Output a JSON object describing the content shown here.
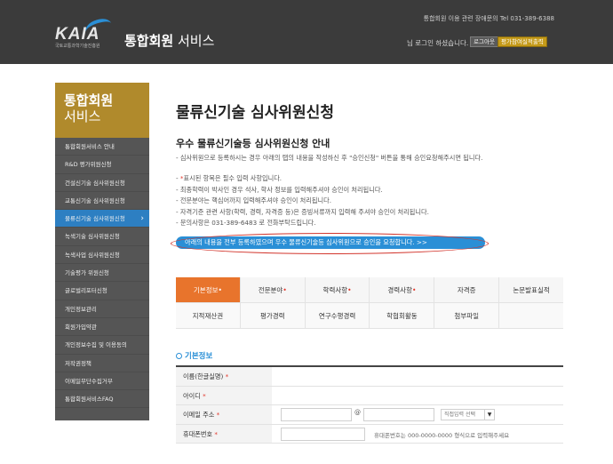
{
  "header": {
    "logo_text": "KAIA",
    "logo_sub": "국토교통과학기술진흥원",
    "service_title_bold": "통합회원",
    "service_title_rest": " 서비스",
    "contact": "통합회원 이용 관련 장애문의 Tel 031-389-6388",
    "login_status": "님 로그인 하셨습니다.",
    "logout_label": "로그아웃",
    "eval_label": "평가참여실적출력"
  },
  "sidebar": {
    "title_line1": "통합회원",
    "title_line2": "서비스",
    "items": [
      {
        "label": "통합회원서비스 안내"
      },
      {
        "label": "R&D 평가위원신청"
      },
      {
        "label": "건설신기술 심사위원신청"
      },
      {
        "label": "교통신기술 심사위원신청"
      },
      {
        "label": "물류신기술 심사위원신청"
      },
      {
        "label": "녹색기술 심사위원신청"
      },
      {
        "label": "녹색사업 심사위원신청"
      },
      {
        "label": "기술평가 위원신청"
      },
      {
        "label": "글로벌리포터신청"
      },
      {
        "label": "개인정보관리"
      },
      {
        "label": "회원가입약관"
      },
      {
        "label": "개인정보수집 및 이용동의"
      },
      {
        "label": "저작권정책"
      },
      {
        "label": "이메일무단수집거부"
      },
      {
        "label": "통합회원서비스FAQ"
      }
    ]
  },
  "main": {
    "page_title": "물류신기술 심사위원신청",
    "section_title": "우수 물류신기술등 심사위원신청 안내",
    "intro": "- 심사위원으로 등록하시는 경우 아래의 탭의 내용을 작성하신 후 \"승인신청\" 버튼을 통해 승인요청해주시면 됩니다.",
    "note_required_prefix": "- ",
    "note_required_mark": "*",
    "note_required_text": "표시된 항목은 필수 입력 사항입니다.",
    "notes": [
      "- 최종학력이 박사인 경우 석사, 학사 정보를 입력해주셔야 승인이 처리됩니다.",
      "- 전문분야는 핵심어까지 입력해주셔야 승인이 처리됩니다.",
      "- 자격기준 관련 사항(학력, 경력, 자격증 등)은 증빙서류까지 입력해 주셔야 승인이 처리됩니다.",
      "- 문의사항은 031-389-6483 로 전화부탁드립니다."
    ],
    "request_link": "아래의 내용을 전부 등록하였으며 우수 물류신기술등 심사위원으로 승인을 요청합니다. >>"
  },
  "tabs": {
    "row1": [
      {
        "label": "기본정보",
        "required": "•"
      },
      {
        "label": "전문분야",
        "required": "•"
      },
      {
        "label": "학력사항",
        "required": "•"
      },
      {
        "label": "경력사항",
        "required": "•"
      },
      {
        "label": "자격증",
        "required": ""
      },
      {
        "label": "논문발표실적",
        "required": ""
      }
    ],
    "row2": [
      {
        "label": "지적재산권"
      },
      {
        "label": "평가경력"
      },
      {
        "label": "연구수행경력"
      },
      {
        "label": "학협회활동"
      },
      {
        "label": "첨부파일"
      },
      {
        "label": ""
      }
    ]
  },
  "basic_info": {
    "heading": "기본정보",
    "name_label": "이름(한글실명)",
    "id_label": "아이디",
    "email_label": "이메일 주소",
    "email_at": "@",
    "email_domain_select": "직접입력 선택",
    "phone_label": "휴대폰번호",
    "phone_hint": "휴대폰번호는 000-0000-0000 형식으로 입력해주세요",
    "required_mark": "*"
  }
}
